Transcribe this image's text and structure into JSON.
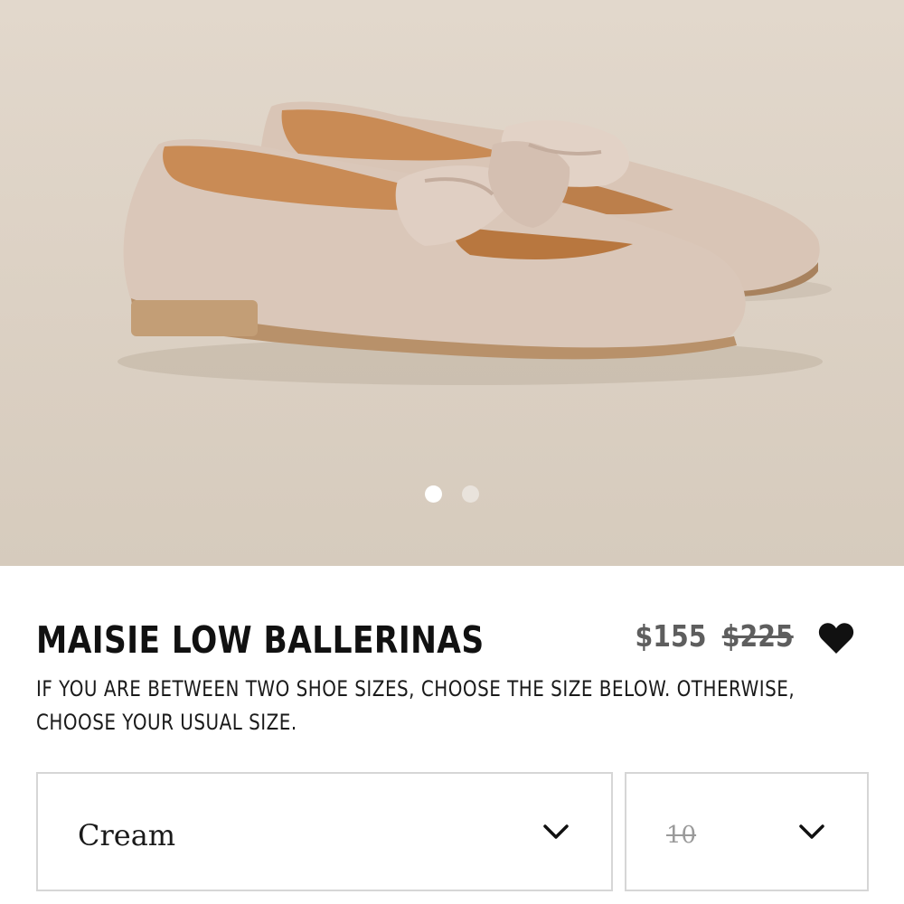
{
  "gallery": {
    "image_alt": "",
    "slide_count": 2,
    "active_slide": 1
  },
  "product": {
    "title": "MAISIE LOW BALLERINAS",
    "price_current": "$155",
    "price_original": "$225",
    "size_note": "IF YOU ARE BETWEEN TWO SHOE SIZES, CHOOSE THE SIZE BELOW. OTHERWISE, CHOOSE YOUR USUAL SIZE."
  },
  "selectors": {
    "color_value": "Cream",
    "size_value": "10"
  },
  "icons": {
    "wishlist": "heart-icon",
    "dropdown": "chevron-down-icon"
  },
  "colors": {
    "text": "#111111",
    "price": "#5e5e5e",
    "border": "#d6d6d6",
    "background": "#ffffff"
  }
}
